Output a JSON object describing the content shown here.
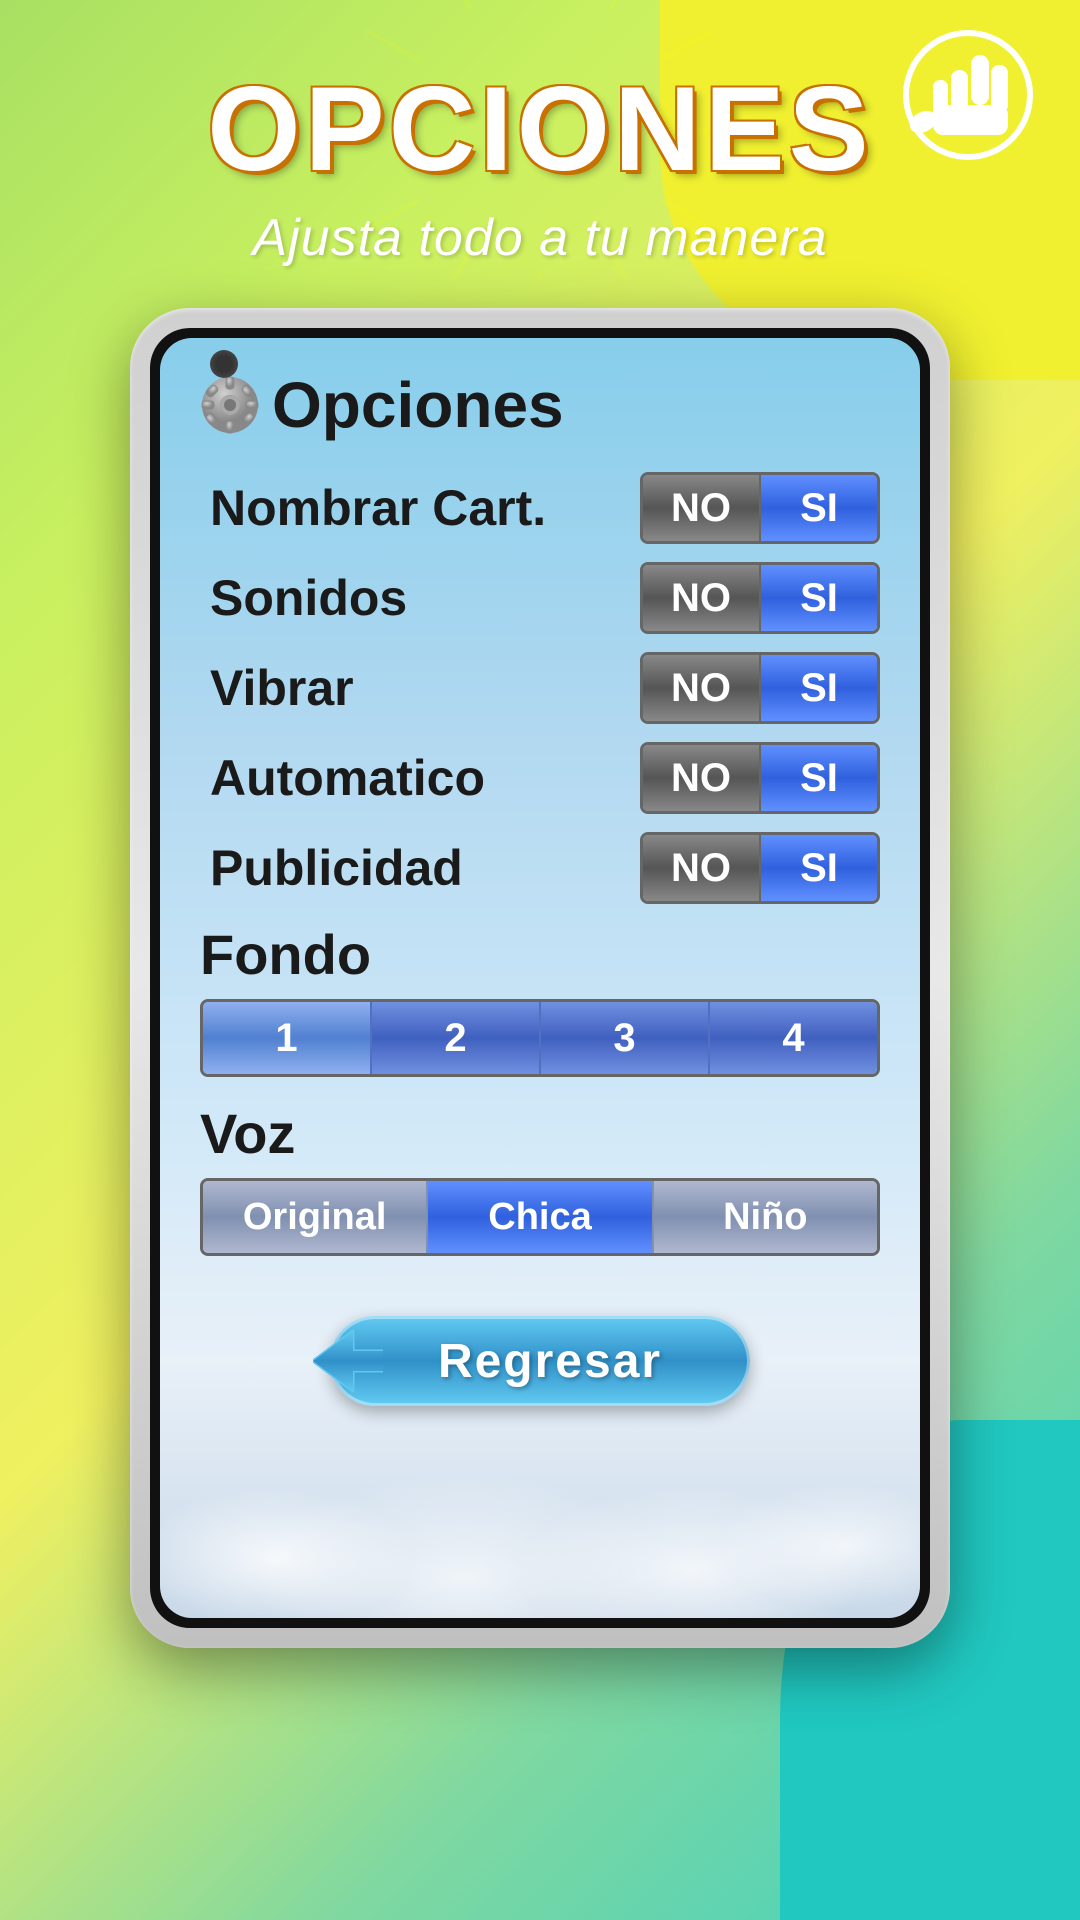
{
  "app": {
    "title": "OPCIONES",
    "subtitle": "Ajusta todo a tu manera"
  },
  "screen": {
    "title": "Opciones",
    "settings": [
      {
        "id": "nombrar_cart",
        "label": "Nombrar Cart.",
        "no_selected": true,
        "si_selected": false
      },
      {
        "id": "sonidos",
        "label": "Sonidos",
        "no_selected": true,
        "si_selected": false
      },
      {
        "id": "vibrar",
        "label": "Vibrar",
        "no_selected": true,
        "si_selected": false
      },
      {
        "id": "automatico",
        "label": "Automatico",
        "no_selected": true,
        "si_selected": false
      },
      {
        "id": "publicidad",
        "label": "Publicidad",
        "no_selected": true,
        "si_selected": false
      }
    ],
    "fondo": {
      "label": "Fondo",
      "options": [
        "1",
        "2",
        "3",
        "4"
      ],
      "selected": 0
    },
    "voz": {
      "label": "Voz",
      "options": [
        "Original",
        "Chica",
        "Niño"
      ],
      "selected": 1
    },
    "toggle_no": "NO",
    "toggle_si": "SI",
    "back_button": "Regresar"
  }
}
